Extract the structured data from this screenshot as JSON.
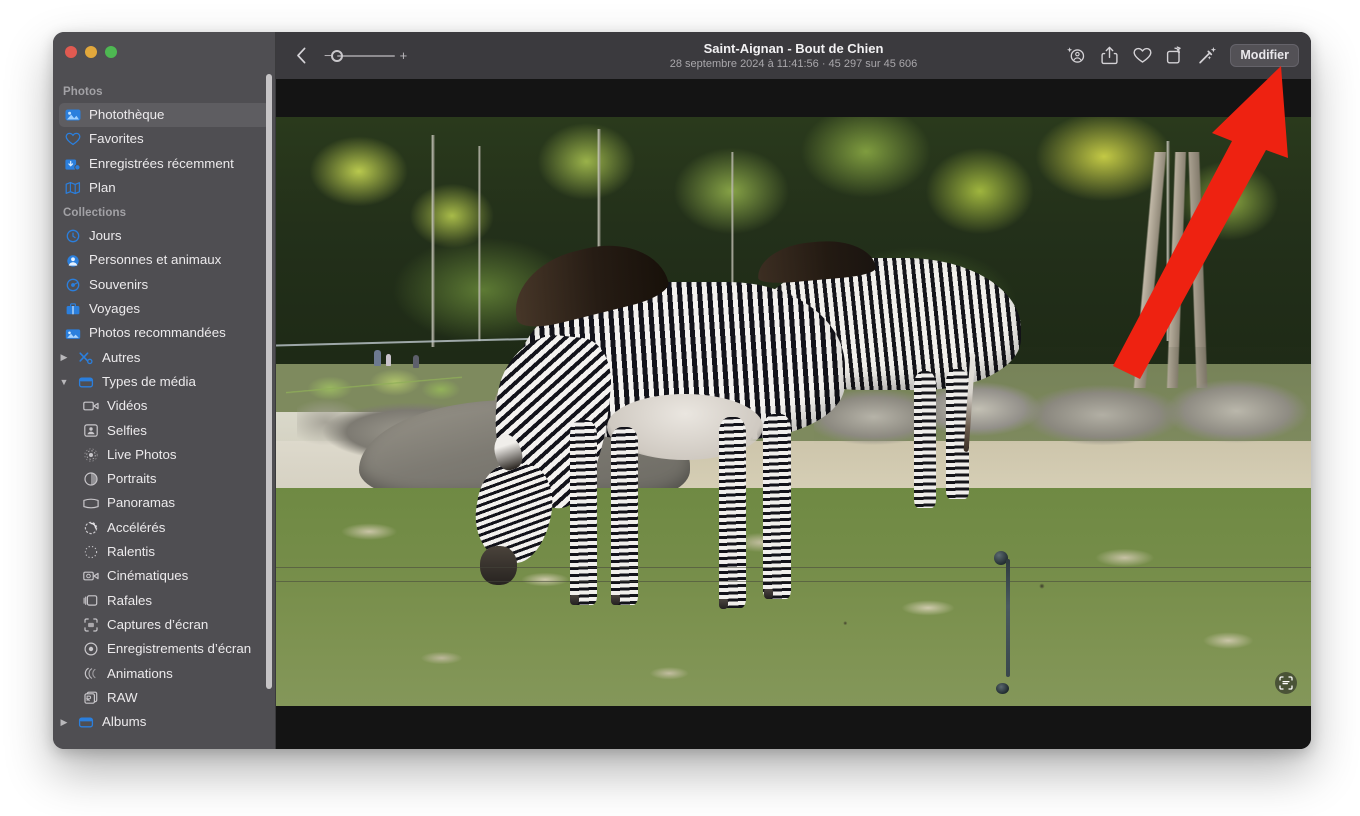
{
  "app": {
    "name": "Photos",
    "window_controls": [
      "close",
      "minimize",
      "maximize"
    ]
  },
  "sidebar": {
    "sections": [
      {
        "label": "Photos",
        "items": [
          {
            "label": "Photothèque",
            "icon": "photo-library-icon",
            "selected": true
          },
          {
            "label": "Favorites",
            "icon": "heart-icon",
            "selected": false
          },
          {
            "label": "Enregistrées récemment",
            "icon": "recently-saved-icon",
            "selected": false
          },
          {
            "label": "Plan",
            "icon": "map-icon",
            "selected": false
          }
        ]
      },
      {
        "label": "Collections",
        "items": [
          {
            "label": "Jours",
            "icon": "clock-icon",
            "selected": false
          },
          {
            "label": "Personnes et animaux",
            "icon": "people-icon",
            "selected": false
          },
          {
            "label": "Souvenirs",
            "icon": "memories-icon",
            "selected": false
          },
          {
            "label": "Voyages",
            "icon": "trips-icon",
            "selected": false
          },
          {
            "label": "Photos recommandées",
            "icon": "featured-photos-icon",
            "selected": false
          },
          {
            "label": "Autres",
            "icon": "utilities-icon",
            "selected": false,
            "twisty": "collapsed"
          },
          {
            "label": "Types de média",
            "icon": "media-types-icon",
            "selected": false,
            "twisty": "expanded"
          }
        ]
      }
    ],
    "media_types": [
      {
        "label": "Vidéos",
        "icon": "video-icon"
      },
      {
        "label": "Selfies",
        "icon": "selfie-icon"
      },
      {
        "label": "Live Photos",
        "icon": "live-photo-icon"
      },
      {
        "label": "Portraits",
        "icon": "portrait-icon"
      },
      {
        "label": "Panoramas",
        "icon": "panorama-icon"
      },
      {
        "label": "Accélérés",
        "icon": "timelapse-icon"
      },
      {
        "label": "Ralentis",
        "icon": "slomo-icon"
      },
      {
        "label": "Cinématiques",
        "icon": "cinematic-icon"
      },
      {
        "label": "Rafales",
        "icon": "burst-icon"
      },
      {
        "label": "Captures d’écran",
        "icon": "screenshot-icon"
      },
      {
        "label": "Enregistrements d’écran",
        "icon": "screen-recording-icon"
      },
      {
        "label": "Animations",
        "icon": "animation-icon"
      },
      {
        "label": "RAW",
        "icon": "raw-icon"
      }
    ],
    "albums": {
      "label": "Albums",
      "icon": "albums-icon",
      "twisty": "collapsed"
    }
  },
  "toolbar": {
    "back_icon": "chevron-left-icon",
    "zoom_out_label": "−",
    "zoom_in_label": "+",
    "title": "Saint-Aignan - Bout de Chien",
    "subtitle": "28 septembre 2024 à 11:41:56  ·  45 297 sur 45 606",
    "actions": [
      {
        "name": "info-ai-icon",
        "label": "Informations"
      },
      {
        "name": "share-icon",
        "label": "Partager"
      },
      {
        "name": "favorite-heart-icon",
        "label": "Favori"
      },
      {
        "name": "rotate-icon",
        "label": "Faire pivoter"
      },
      {
        "name": "auto-enhance-icon",
        "label": "Améliorer"
      }
    ],
    "edit_label": "Modifier"
  },
  "viewer": {
    "overlay_icon": "live-text-icon",
    "photo_alt": "Deux zèbres dans un enclos de zoo, herbe et rochers"
  },
  "annotation": {
    "arrow_color": "#ee2211",
    "points_to": "Modifier"
  },
  "colors": {
    "sidebar_bg": "#4f4e52",
    "toolbar_bg": "#3b3a3e",
    "selection": "#5e5d61",
    "accent_blue": "#2b7fdd",
    "letterbox": "#141414"
  }
}
